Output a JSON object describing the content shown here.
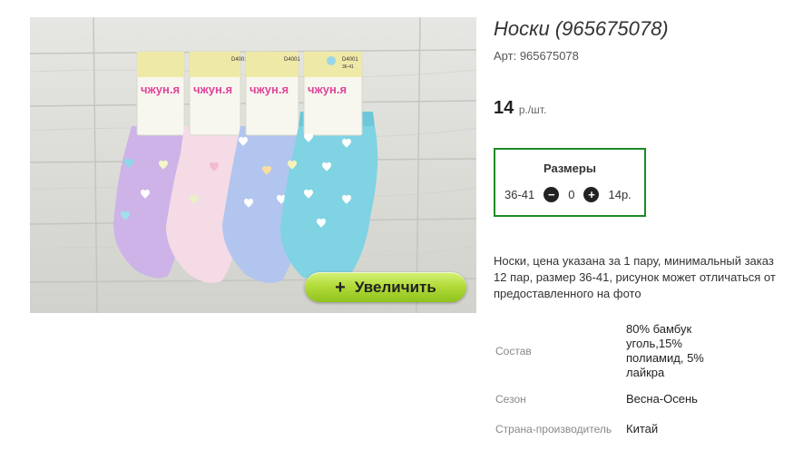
{
  "product": {
    "title": "Носки (965675078)",
    "sku_label": "Арт:",
    "sku_value": "965675078",
    "price_value": "14",
    "price_unit": "р./шт."
  },
  "image": {
    "zoom_icon": "+",
    "zoom_label": "Увеличить",
    "package_brand": "чжун.я",
    "package_code": "D4001",
    "package_size": "36-41"
  },
  "sizes": {
    "title": "Размеры",
    "size": "36-41",
    "quantity": "0",
    "price": "14р.",
    "minus_icon": "−",
    "plus_icon": "+"
  },
  "description": "Носки, цена указана за 1 пару, минимальный заказ 12 пар, размер 36-41, рисунок может отличаться от предоставленного на фото",
  "properties": [
    {
      "label": "Состав",
      "value": "80% бамбук уголь,15% полиамид, 5% лайкра"
    },
    {
      "label": "Сезон",
      "value": "Весна-Осень"
    },
    {
      "label": "Страна-производитель",
      "value": "Китай"
    }
  ],
  "colors": {
    "sizes_border": "#1e8a25",
    "zoom_button": "#b3dc3a",
    "sock_lilac": "#cdb3e8",
    "sock_pink": "#f4dbe6",
    "sock_blue": "#b2c5ee",
    "sock_aqua": "#7fd3e3"
  }
}
